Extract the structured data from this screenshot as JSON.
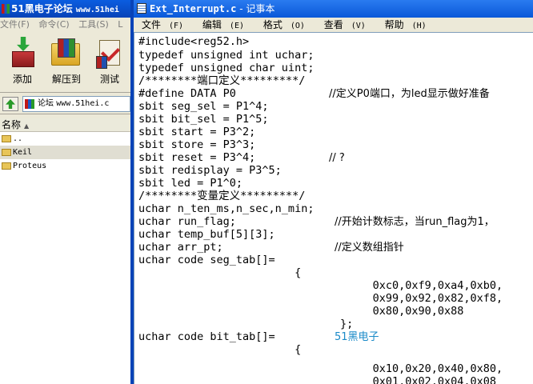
{
  "left_window": {
    "title": "51黑电子论坛",
    "title_url": "www.51hei",
    "menu": [
      "文件(F)",
      "命令(C)",
      "工具(S)",
      "L"
    ],
    "toolbar": [
      "添加",
      "解压到",
      "测试"
    ],
    "address": {
      "prefix": "论坛",
      "url": "www.51hei.c"
    },
    "list_header": "名称",
    "files": [
      ".. ",
      "Keil",
      "Proteus"
    ]
  },
  "notepad": {
    "title": "Ext_Interrupt.c",
    "title_suffix": " - 记事本",
    "menu": [
      {
        "label": "文件",
        "hot": "(F)"
      },
      {
        "label": "编辑",
        "hot": "(E)"
      },
      {
        "label": "格式",
        "hot": "(O)"
      },
      {
        "label": "查看",
        "hot": "(V)"
      },
      {
        "label": "帮助",
        "hot": "(H)"
      }
    ],
    "code": [
      "#include<reg52.h>",
      "typedef unsigned int uchar;",
      "typedef unsigned char uint;",
      "/********端口定义*********/",
      "#define DATA P0",
      "sbit seg_sel = P1^4;",
      "sbit bit_sel = P1^5;",
      "sbit start = P3^2;",
      "sbit store = P3^3;",
      "sbit reset = P3^4;",
      "sbit redisplay = P3^5;",
      "sbit led = P1^0;",
      "/********变量定义*********/",
      "uchar n_ten_ms,n_sec,n_min;",
      "uchar run_flag;",
      "uchar temp_buf[5][3];",
      "uchar arr_pt;",
      "uchar code seg_tab[]=",
      "                        {",
      "                                    0xc0,0xf9,0xa4,0xb0,",
      "                                    0x99,0x92,0x82,0xf8,",
      "                                    0x80,0x90,0x88",
      "                               };",
      "",
      "uchar code bit_tab[]=",
      "                        {",
      "",
      "                                    0x10,0x20,0x40,0x80,",
      "                                    0x01,0x02,0x04,0x08",
      "                               }"
    ],
    "comments": {
      "define_data": "//定义P0端口，为led显示做好准备",
      "reset": "// ?",
      "run_flag": "//开始计数标志，当run_flag为1，",
      "arr_pt": "//定义数组指针"
    },
    "watermark": "51黑电子",
    "watermark_color": "#1a8ac8"
  }
}
